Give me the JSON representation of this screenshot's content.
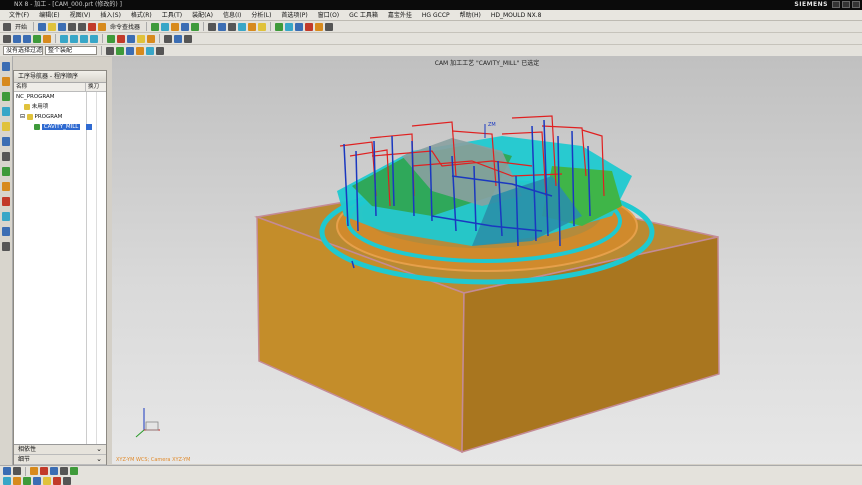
{
  "titlebar": {
    "title": "NX 8 - 加工 - [CAM_000.prt (修改的) ]",
    "brand": "SIEMENS"
  },
  "menubar": {
    "items": [
      "文件(F)",
      "编辑(E)",
      "视图(V)",
      "插入(S)",
      "格式(R)",
      "工具(T)",
      "装配(A)",
      "信息(I)",
      "分析(L)",
      "首选项(P)",
      "窗口(O)",
      "GC 工具箱",
      "嘉宝外挂",
      "HG GCCP",
      "帮助(H)",
      "HD_MOULD NX.8"
    ]
  },
  "toolbar1": {
    "start_label": "开始",
    "command_finder": "命令查找器"
  },
  "toolbar3": {
    "filter_select": "没有选择过滤器",
    "assembly_select": "整个装配"
  },
  "navigator": {
    "title": "工序导航器 - 程序顺序",
    "col_name": "名称",
    "col_toolchange": "换刀",
    "rows": [
      "NC_PROGRAM",
      "未用项",
      "PROGRAM",
      "CAVITY_MILL"
    ]
  },
  "panels": {
    "dependencies": "相依性",
    "details": "细节"
  },
  "viewport": {
    "title": "CAM 加工工艺 \"CAVITY_MILL\" 已选定",
    "status": "XYZ-YM WCS; Camera XYZ-YM",
    "zm_label": "ZM"
  },
  "colors": {
    "stock_top": "#b98a32",
    "stock_front": "#c48d2a",
    "stock_side": "#a9761f",
    "edge": "#c48b96",
    "cut_rapid": "#e02020",
    "cut_feed": "#1a38c0",
    "part_cyan": "#1fc9d0",
    "part_green": "#3fb548",
    "selection": "#2f6ad1"
  }
}
